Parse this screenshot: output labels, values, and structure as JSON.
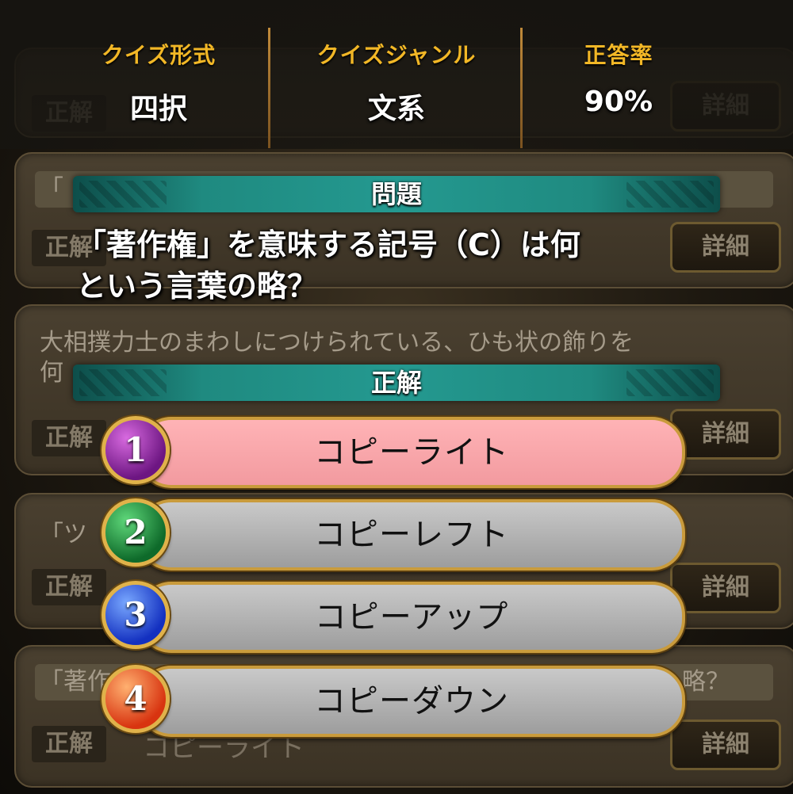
{
  "header": {
    "format_label": "クイズ形式",
    "format_value": "四択",
    "genre_label": "クイズジャンル",
    "genre_value": "文系",
    "rate_label": "正答率",
    "rate_value": "90%"
  },
  "question_banner": "問題",
  "question_text_line1": "「著作権」を意味する記号（C）は何",
  "question_text_line2": "という言葉の略？",
  "answer_banner": "正解",
  "choices": [
    {
      "number": "1",
      "label": "コピーライト",
      "correct": true
    },
    {
      "number": "2",
      "label": "コピーレフト",
      "correct": false
    },
    {
      "number": "3",
      "label": "コピーアップ",
      "correct": false
    },
    {
      "number": "4",
      "label": "コピーダウン",
      "correct": false
    }
  ],
  "history": {
    "tag_label": "正解",
    "detail_label": "詳細",
    "card2_question_fragment": "「",
    "card3_question": "大相撲力士のまわしにつけられている、ひも状の飾りを",
    "card3_question_line2": "何",
    "card4_question_fragment": "「ツ",
    "card5_question_fragment": "「著作",
    "card5_question_tail": "略？",
    "card5_answer": "コピーライト"
  }
}
